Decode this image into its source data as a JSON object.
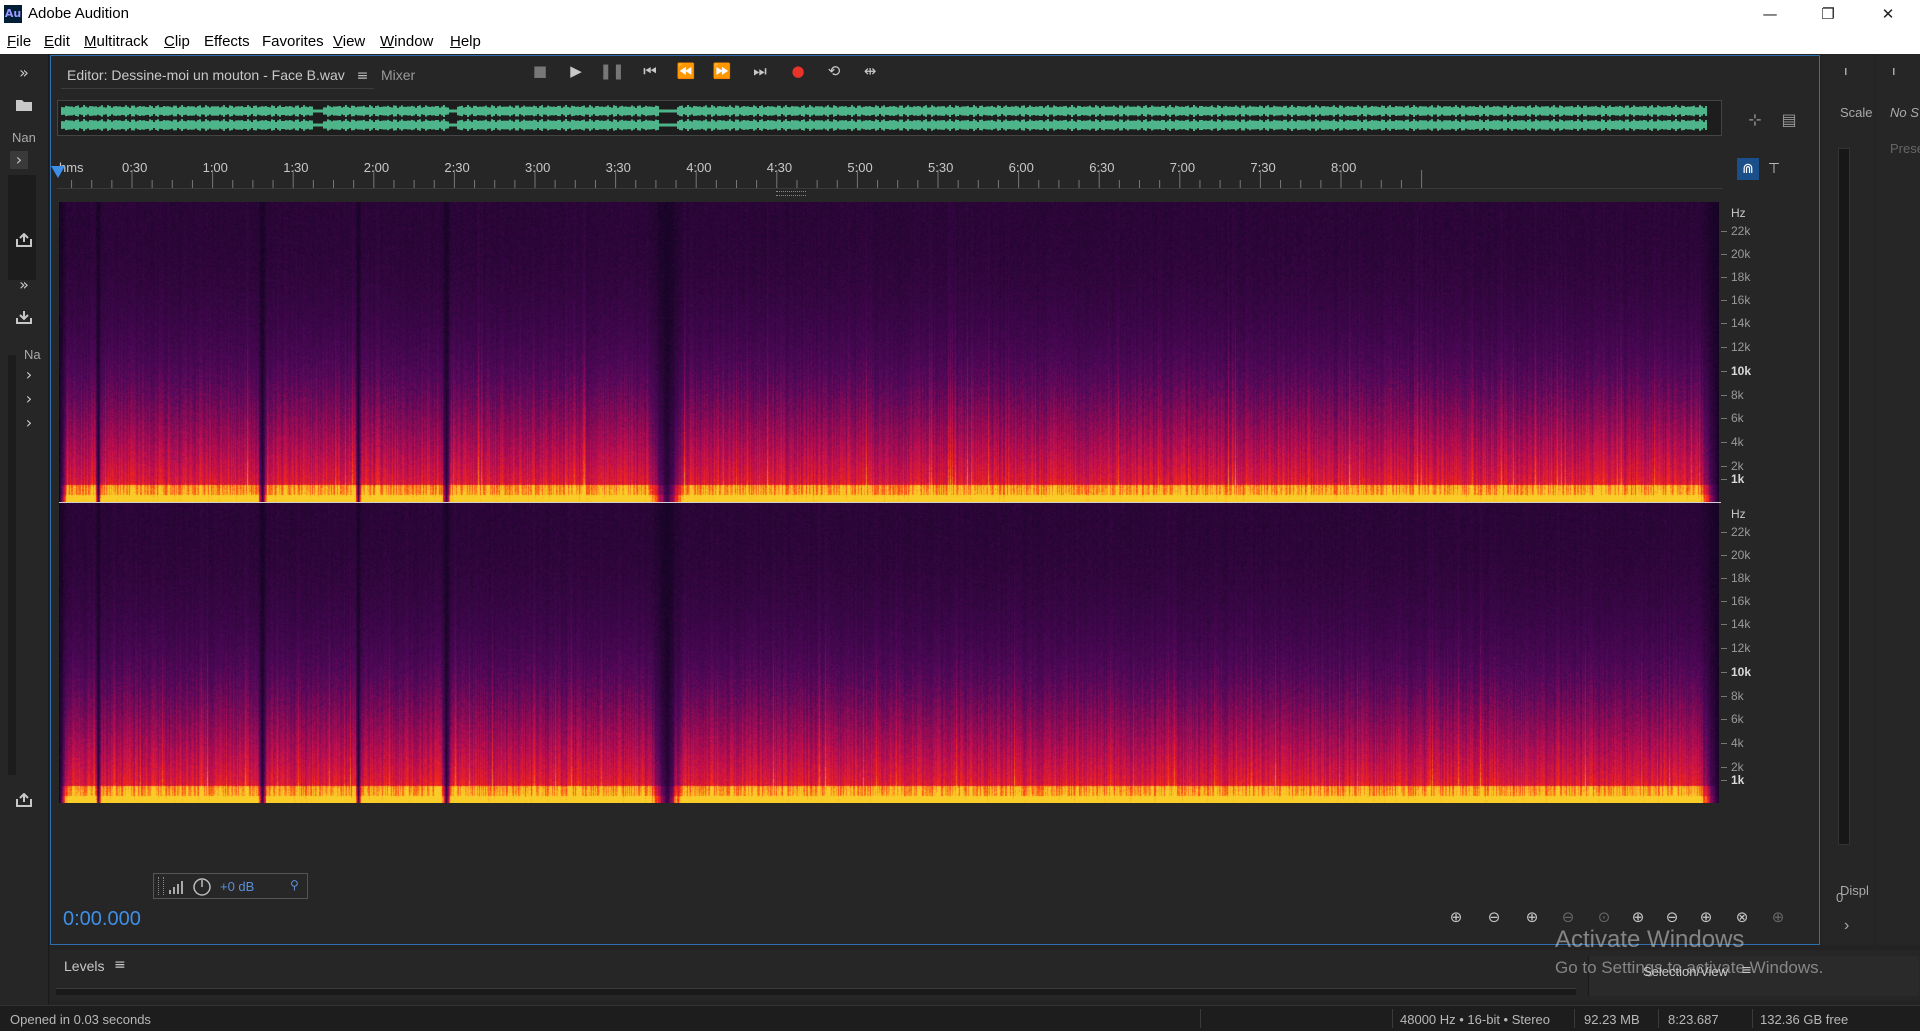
{
  "window": {
    "app_icon_text": "Au",
    "title": "Adobe Audition",
    "minimize_glyph": "—",
    "maximize_glyph": "❐",
    "close_glyph": "✕"
  },
  "menu": {
    "items": [
      {
        "underline": "F",
        "rest": "ile"
      },
      {
        "underline": "E",
        "rest": "dit"
      },
      {
        "underline": "M",
        "rest": "ultitrack"
      },
      {
        "underline": "C",
        "rest": "lip"
      },
      {
        "underline": "",
        "rest": "Effects"
      },
      {
        "underline": "",
        "rest": "Favorites"
      },
      {
        "underline": "V",
        "rest": "iew"
      },
      {
        "underline": "W",
        "rest": "indow"
      },
      {
        "underline": "H",
        "rest": "elp"
      }
    ]
  },
  "left_panel": {
    "expand_glyph": "»",
    "folder_icon": "folder-icon",
    "name_label_1": "Nan",
    "name_label_2": "Na",
    "chevron_glyph": "›"
  },
  "editor": {
    "tab_label": "Editor: Dessine-moi un mouton - Face B.wav",
    "tab_menu_glyph": "≡",
    "mixer_label": "Mixer",
    "time_format_label": "hms",
    "time_labels": [
      "0:30",
      "1:00",
      "1:30",
      "2:00",
      "2:30",
      "3:00",
      "3:30",
      "4:00",
      "4:30",
      "5:00",
      "5:30",
      "6:00",
      "6:30",
      "7:00",
      "7:30",
      "8:00"
    ],
    "hz_unit": "Hz",
    "hz_labels": [
      "22k",
      "20k",
      "18k",
      "16k",
      "14k",
      "12k",
      "10k",
      "8k",
      "6k",
      "4k",
      "2k",
      "1k"
    ],
    "hud_gain": "+0 dB",
    "current_time": "0:00.000"
  },
  "right_panel": {
    "scale_label": "Scale",
    "no_selection_label": "No S",
    "preset_label": "Prese",
    "meter_zero": "0",
    "display_label": "Displ",
    "pin_glyph": "ı"
  },
  "levels": {
    "title": "Levels",
    "menu_glyph": "≡",
    "selection_view": "Selection/View",
    "selection_menu_glyph": "≡"
  },
  "watermark": {
    "line1": "Activate Windows",
    "line2": "Go to Settings to activate Windows."
  },
  "status": {
    "message": "Opened in 0.03 seconds",
    "format": "48000 Hz • 16-bit • Stereo",
    "file_size": "92.23 MB",
    "duration": "8:23.687",
    "free_space": "132.36 GB free"
  },
  "colors": {
    "accent_blue": "#3f8fe6",
    "waveform_green": "#5fe8b0",
    "record_red": "#e8332a"
  }
}
